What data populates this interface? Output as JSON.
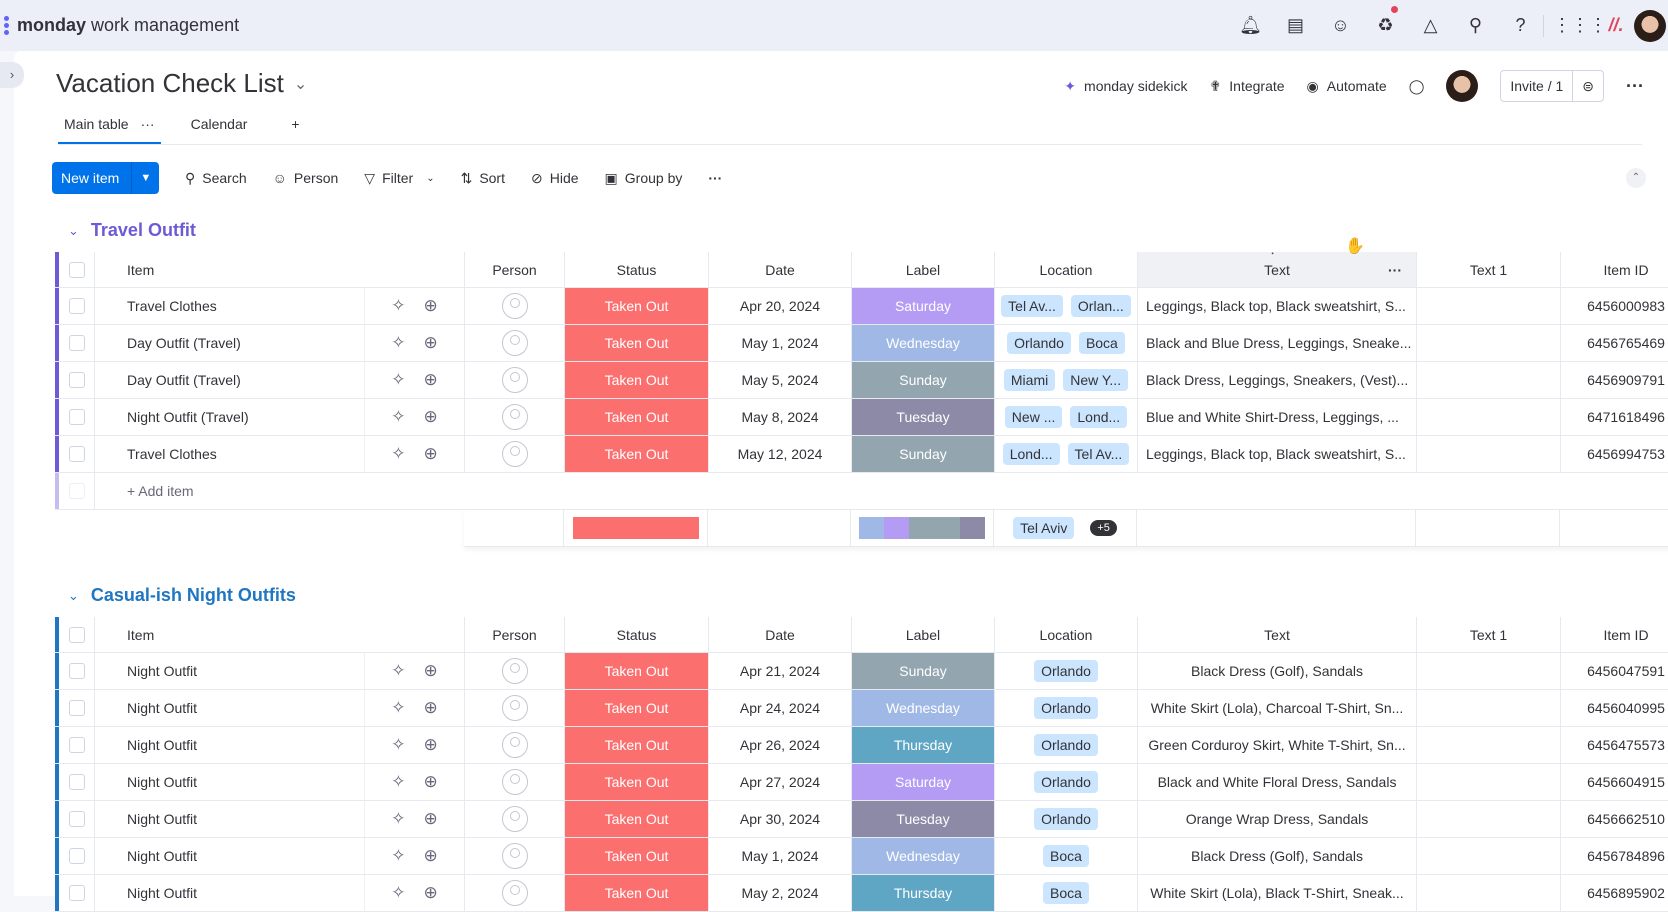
{
  "app": {
    "brand": "monday",
    "product": "work management"
  },
  "topbar_icons": [
    "bell-icon",
    "inbox-icon",
    "invite-member-icon",
    "apps-puzzle-icon",
    "workflows-icon",
    "search-icon",
    "help-icon",
    "grid-apps-icon"
  ],
  "board": {
    "title": "Vacation Check List",
    "actions": {
      "sidekick": "monday sidekick",
      "integrate": "Integrate",
      "automate": "Automate",
      "invite": "Invite / 1"
    },
    "tabs": [
      {
        "label": "Main table",
        "active": true
      },
      {
        "label": "Calendar",
        "active": false
      }
    ],
    "add_tab": "+"
  },
  "toolbar": {
    "new_item": "New item",
    "search": "Search",
    "person": "Person",
    "filter": "Filter",
    "sort": "Sort",
    "hide": "Hide",
    "group_by": "Group by"
  },
  "columns": {
    "item": "Item",
    "person": "Person",
    "status": "Status",
    "date": "Date",
    "label": "Label",
    "location": "Location",
    "text": "Text",
    "text1": "Text 1",
    "item_id": "Item ID"
  },
  "colors": {
    "status_taken_out": "#fb6f6f",
    "Saturday": "#b49cf5",
    "Wednesday": "#a0b8e6",
    "Sunday": "#93a6b0",
    "Tuesday": "#8d8aa8",
    "Thursday": "#5fa6c4",
    "group1": "#6c5ad6",
    "group2": "#1f76c2"
  },
  "groups": [
    {
      "title": "Travel Outfit",
      "color": "#6c5ad6",
      "add_item": "+ Add item",
      "rows": [
        {
          "item": "Travel Clothes",
          "status": "Taken Out",
          "date": "Apr 20, 2024",
          "label": "Saturday",
          "location": [
            "Tel Av...",
            "Orlan..."
          ],
          "text": "Leggings, Black top, Black sweatshirt, S...",
          "text1": "",
          "id": "6456000983"
        },
        {
          "item": "Day Outfit (Travel)",
          "status": "Taken Out",
          "date": "May 1, 2024",
          "label": "Wednesday",
          "location": [
            "Orlando",
            "Boca"
          ],
          "text": "Black and Blue Dress, Leggings, Sneake...",
          "text1": "",
          "id": "6456765469"
        },
        {
          "item": "Day Outfit (Travel)",
          "status": "Taken Out",
          "date": "May 5, 2024",
          "label": "Sunday",
          "location": [
            "Miami",
            "New Y..."
          ],
          "text": "Black Dress, Leggings, Sneakers, (Vest)...",
          "text1": "",
          "id": "6456909791"
        },
        {
          "item": "Night Outfit (Travel)",
          "status": "Taken Out",
          "date": "May 8, 2024",
          "label": "Tuesday",
          "location": [
            "New ...",
            "Lond..."
          ],
          "text": "Blue and White Shirt-Dress, Leggings, ...",
          "text1": "",
          "id": "6471618496"
        },
        {
          "item": "Travel Clothes",
          "status": "Taken Out",
          "date": "May 12, 2024",
          "label": "Sunday",
          "location": [
            "Lond...",
            "Tel Av..."
          ],
          "text": "Leggings, Black top, Black sweatshirt, S...",
          "text1": "",
          "id": "6456994753"
        }
      ],
      "summary": {
        "status_distribution": [
          {
            "status": "Taken Out",
            "fraction": 1.0
          }
        ],
        "label_distribution": [
          {
            "label": "Wednesday",
            "fraction": 0.2
          },
          {
            "label": "Saturday",
            "fraction": 0.2
          },
          {
            "label": "Sunday",
            "fraction": 0.4
          },
          {
            "label": "Tuesday",
            "fraction": 0.2
          }
        ],
        "location_first": "Tel Aviv",
        "location_more": "+5"
      }
    },
    {
      "title": "Casual-ish Night Outfits",
      "color": "#1f76c2",
      "rows": [
        {
          "item": "Night Outfit",
          "status": "Taken Out",
          "date": "Apr 21, 2024",
          "label": "Sunday",
          "location": [
            "Orlando"
          ],
          "text": "Black Dress (Golf), Sandals",
          "text1": "",
          "id": "6456047591"
        },
        {
          "item": "Night Outfit",
          "status": "Taken Out",
          "date": "Apr 24, 2024",
          "label": "Wednesday",
          "location": [
            "Orlando"
          ],
          "text": "White Skirt (Lola), Charcoal T-Shirt, Sn...",
          "text1": "",
          "id": "6456040995"
        },
        {
          "item": "Night Outfit",
          "status": "Taken Out",
          "date": "Apr 26, 2024",
          "label": "Thursday",
          "location": [
            "Orlando"
          ],
          "text": "Green Corduroy Skirt, White T-Shirt, Sn...",
          "text1": "",
          "id": "6456475573"
        },
        {
          "item": "Night Outfit",
          "status": "Taken Out",
          "date": "Apr 27, 2024",
          "label": "Saturday",
          "location": [
            "Orlando"
          ],
          "text": "Black and White Floral Dress, Sandals",
          "text1": "",
          "id": "6456604915"
        },
        {
          "item": "Night Outfit",
          "status": "Taken Out",
          "date": "Apr 30, 2024",
          "label": "Tuesday",
          "location": [
            "Orlando"
          ],
          "text": "Orange Wrap Dress, Sandals",
          "text1": "",
          "id": "6456662510"
        },
        {
          "item": "Night Outfit",
          "status": "Taken Out",
          "date": "May 1, 2024",
          "label": "Wednesday",
          "location": [
            "Boca"
          ],
          "text": "Black Dress (Golf), Sandals",
          "text1": "",
          "id": "6456784896"
        },
        {
          "item": "Night Outfit",
          "status": "Taken Out",
          "date": "May 2, 2024",
          "label": "Thursday",
          "location": [
            "Boca"
          ],
          "text": "White Skirt (Lola), Black T-Shirt, Sneak...",
          "text1": "",
          "id": "6456895902"
        }
      ]
    }
  ]
}
